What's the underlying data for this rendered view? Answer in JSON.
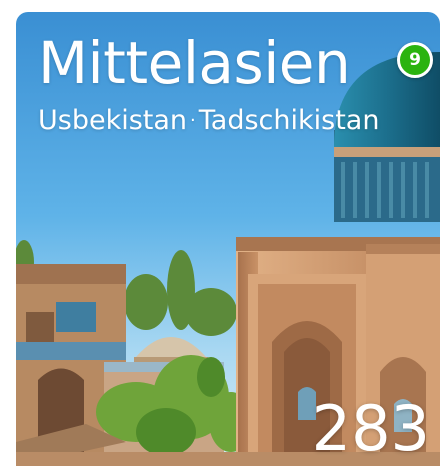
{
  "card": {
    "title": "Mittelasien",
    "countries": [
      "Usbekistan",
      "Tadschikistan"
    ],
    "separator": "·",
    "badge": "9",
    "count": "283"
  },
  "colors": {
    "badge_green": "#2bb30f",
    "sky": "#4aa6e0",
    "dome_blue": "#1f6f8f",
    "sandstone": "#c8936a"
  }
}
